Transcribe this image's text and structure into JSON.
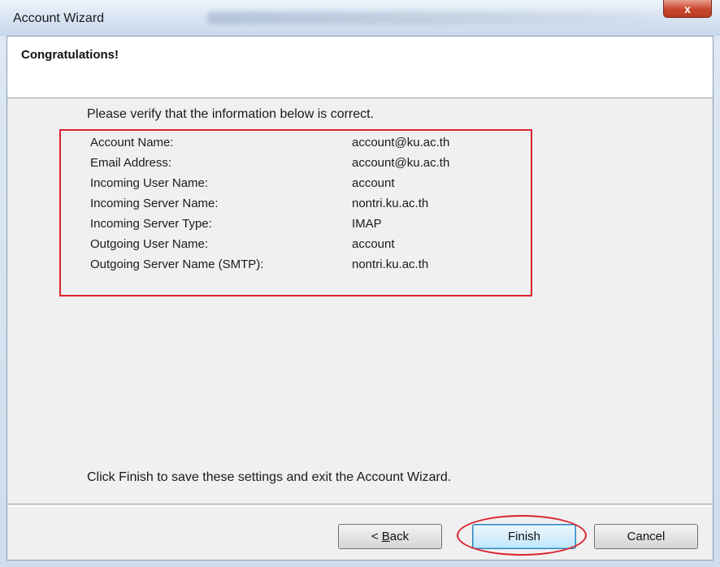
{
  "window": {
    "title": "Account Wizard",
    "close_label": "x"
  },
  "header": {
    "title": "Congratulations!"
  },
  "main": {
    "intro": "Please verify that the information below is correct.",
    "rows": [
      {
        "label": "Account Name:",
        "value": "account@ku.ac.th"
      },
      {
        "label": "Email Address:",
        "value": "account@ku.ac.th"
      },
      {
        "label": "Incoming User Name:",
        "value": "account"
      },
      {
        "label": "Incoming Server Name:",
        "value": "nontri.ku.ac.th"
      },
      {
        "label": "Incoming Server Type:",
        "value": "IMAP"
      },
      {
        "label": "Outgoing User Name:",
        "value": "account"
      },
      {
        "label": "Outgoing Server Name (SMTP):",
        "value": "nontri.ku.ac.th"
      }
    ],
    "footer": "Click Finish to save these settings and exit the Account Wizard."
  },
  "buttons": {
    "back_prefix": "< ",
    "back_mnemonic": "B",
    "back_rest": "ack",
    "finish": "Finish",
    "cancel": "Cancel"
  },
  "colors": {
    "highlight": "#d9232e",
    "default_button": "#3c7fb1"
  }
}
